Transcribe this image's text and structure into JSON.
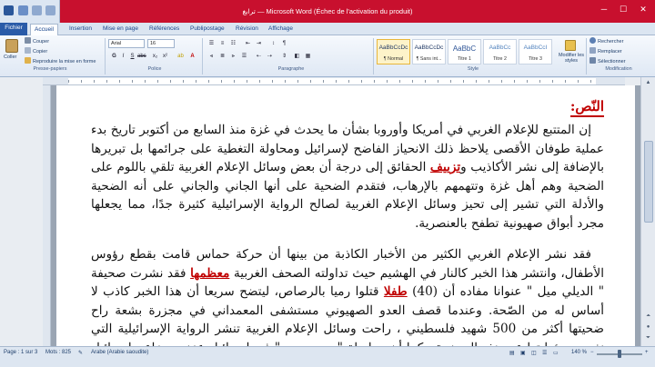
{
  "window": {
    "title": "ترابغ — Microsoft Word (Échec de l'activation du produit)",
    "minimize": "─",
    "maximize": "☐",
    "close": "✕",
    "titlebar_color": "#c8102e"
  },
  "tabs": [
    {
      "label": "Fichier"
    },
    {
      "label": "Accueil"
    },
    {
      "label": "Insertion"
    },
    {
      "label": "Mise en page"
    },
    {
      "label": "Références"
    },
    {
      "label": "Publipostage"
    },
    {
      "label": "Révision"
    },
    {
      "label": "Affichage"
    }
  ],
  "ribbon": {
    "clipboard": {
      "group_label": "Presse-papiers",
      "paste": "Coller",
      "cut": "Couper",
      "copy": "Copier",
      "format_painter": "Reproduire la mise en forme"
    },
    "font": {
      "group_label": "Police",
      "font_name": "Arial",
      "font_size": "16"
    },
    "paragraph": {
      "group_label": "Paragraphe"
    },
    "styles": {
      "group_label": "Style",
      "items": [
        {
          "sample": "AaBbCcDc",
          "name": "¶ Normal"
        },
        {
          "sample": "AaBbCcDc",
          "name": "¶ Sans int..."
        },
        {
          "sample": "AaBbC",
          "name": "Titre 1"
        },
        {
          "sample": "AaBbCc",
          "name": "Titre 2"
        },
        {
          "sample": "AaBbCcI",
          "name": "Titre 3"
        }
      ],
      "change_styles": "Modifier les styles"
    },
    "editing": {
      "group_label": "Modification",
      "find": "Rechercher",
      "replace": "Remplacer",
      "select": "Sélectionner"
    }
  },
  "document": {
    "heading": "النّص:",
    "p1_a": "إن المتتبع للإعلام الغربي في أمريكا وأوروبا بشأن ما يحدث في غزة منذ السابع من أكتوبر تاريخ بدء عملية طوفان الأقصى يلاحظ ذلك الانحياز الفاضح لإسرائيل ومحاولة التغطية على جرائمها بل تبريرها بالإضافة إلى نشر الأكاذيب و",
    "p1_u": "تزييف",
    "p1_b": " الحقائق إلى درجة أن بعض وسائل الإعلام الغربية تلقي باللوم على الضحية وهم أهل غزة وتتهمهم بالإرهاب، فتقدم الضحية على أنها الجاني والجاني على أنه الضحية والأدلة التي تشير إلى تحيز وسائل الإعلام الغربية لصالح الرواية الإسرائيلية كثيرة جدًا، مما يجعلها مجرد أبواق صهيونية تطفح بالعنصرية.",
    "p2_a": "فقد نشر الإعلام الغربي الكثير من الأخبار الكاذبة من بينها أن حركة حماس قامت بقطع رؤوس الأطفال، وانتشر هذا الخبر كالنار في الهشيم حيث تداولته الصحف الغربية ",
    "p2_u1": "معظمها",
    "p2_b": " فقد نشرت صحيفة \" الديلي ميل \" عنوانا مفاده أن (40) ",
    "p2_u2": "طفلا",
    "p2_c": " قتلوا رميا بالرصاص، ليتضح سريعا أن هذا الخبر كاذب لا أساس له من الصّحة. وعندما قصف العدو الصهيوني مستشفى المعمداني في مجزرة بشعة راح ضحيتها أكثر من 500 شهيد فلسطيني ، راحت وسائل الإعلام الغربية تنشر الرواية الإسرائيلية التي نفت مسؤوليتها عن هذه المجزرة ، كما أن مراسلة \"بي بي سي\" في إسرائيل عززت مزاعم إسرائيل بأنّ حماس تبني أنفاقها تحت"
  },
  "status": {
    "page": "Page : 1 sur 3",
    "words": "Mots : 825",
    "language": "Arabe (Arabie saoudite)",
    "zoom": "140 %",
    "zoom_level": 0.4
  }
}
